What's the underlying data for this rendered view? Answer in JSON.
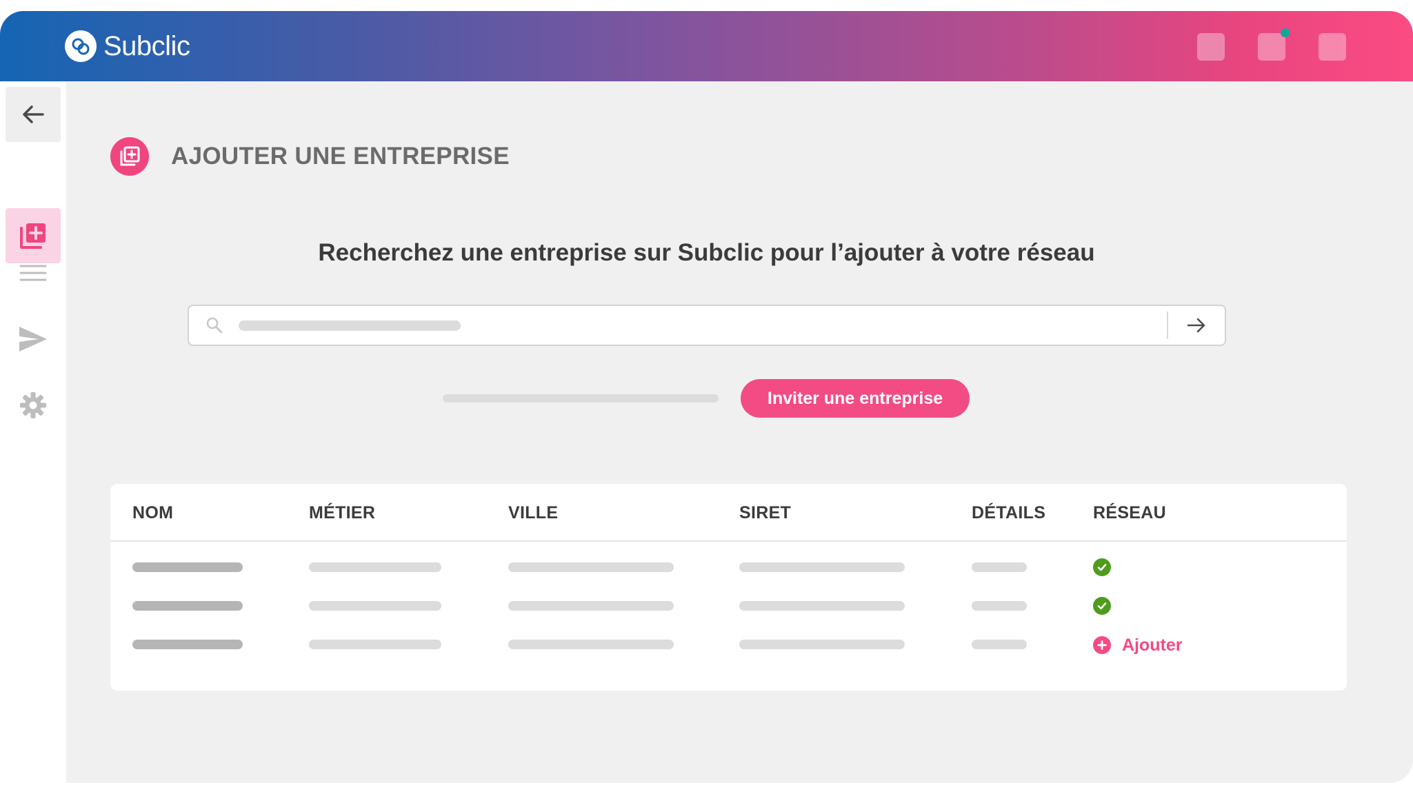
{
  "app": {
    "name": "Subclic",
    "brand_color": "#f34b84",
    "gradient": [
      "#1565b4",
      "#7b55a0",
      "#fb4b83"
    ]
  },
  "topbar": {
    "buttons": [
      {
        "icon": "placeholder-icon"
      },
      {
        "icon": "notification-icon",
        "badge": true
      },
      {
        "icon": "placeholder-icon"
      }
    ]
  },
  "sidebar": {
    "items": [
      {
        "icon": "back-arrow-icon"
      },
      {
        "icon": "add-company-icon",
        "active": true
      },
      {
        "icon": "list-icon"
      },
      {
        "icon": "send-icon"
      },
      {
        "icon": "gear-icon"
      }
    ]
  },
  "page": {
    "title": "AJOUTER UNE ENTREPRISE",
    "subtitle": "Recherchez une entreprise sur Subclic pour l’ajouter à votre réseau"
  },
  "search": {
    "placeholder": ""
  },
  "invite": {
    "button_label": "Inviter une entreprise"
  },
  "table": {
    "columns": [
      "NOM",
      "MÉTIER",
      "VILLE",
      "SIRET",
      "DÉTAILS",
      "RÉSEAU"
    ],
    "rows": [
      {
        "reseau": "check"
      },
      {
        "reseau": "check"
      },
      {
        "reseau": "add",
        "add_label": "Ajouter"
      }
    ]
  }
}
